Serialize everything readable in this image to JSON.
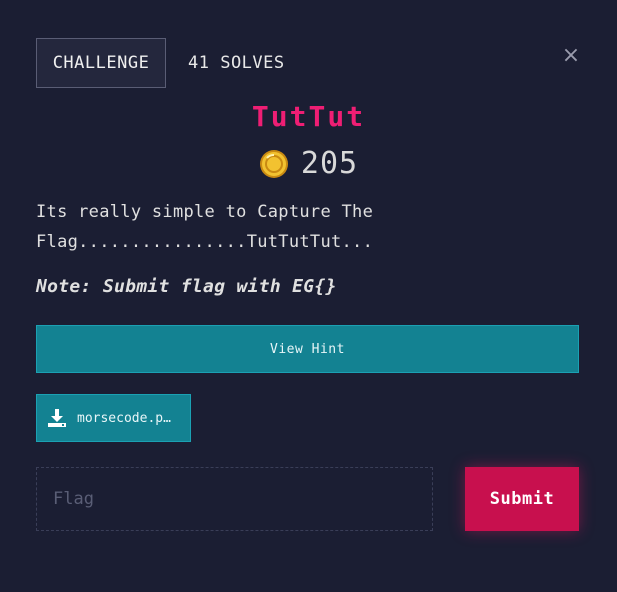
{
  "tabs": {
    "challenge_label": "CHALLENGE",
    "solves_label": "41 SOLVES"
  },
  "close": {
    "glyph": "×"
  },
  "challenge": {
    "title": "TutTut",
    "points": "205",
    "description": "Its really simple to Capture The Flag................TutTutTut...",
    "note": "Note: Submit flag with EG{}"
  },
  "buttons": {
    "hint_label": "View Hint",
    "file_label": "morsecode.p…",
    "submit_label": "Submit"
  },
  "flag_input": {
    "placeholder": "Flag",
    "value": ""
  },
  "icons": {
    "coin": "coin-icon",
    "download": "download-icon",
    "close": "close-icon"
  },
  "colors": {
    "background": "#1b1e33",
    "title": "#ef1e74",
    "accent_teal": "#138292",
    "submit": "#c8104e",
    "coin_gold": "#f2c230"
  }
}
